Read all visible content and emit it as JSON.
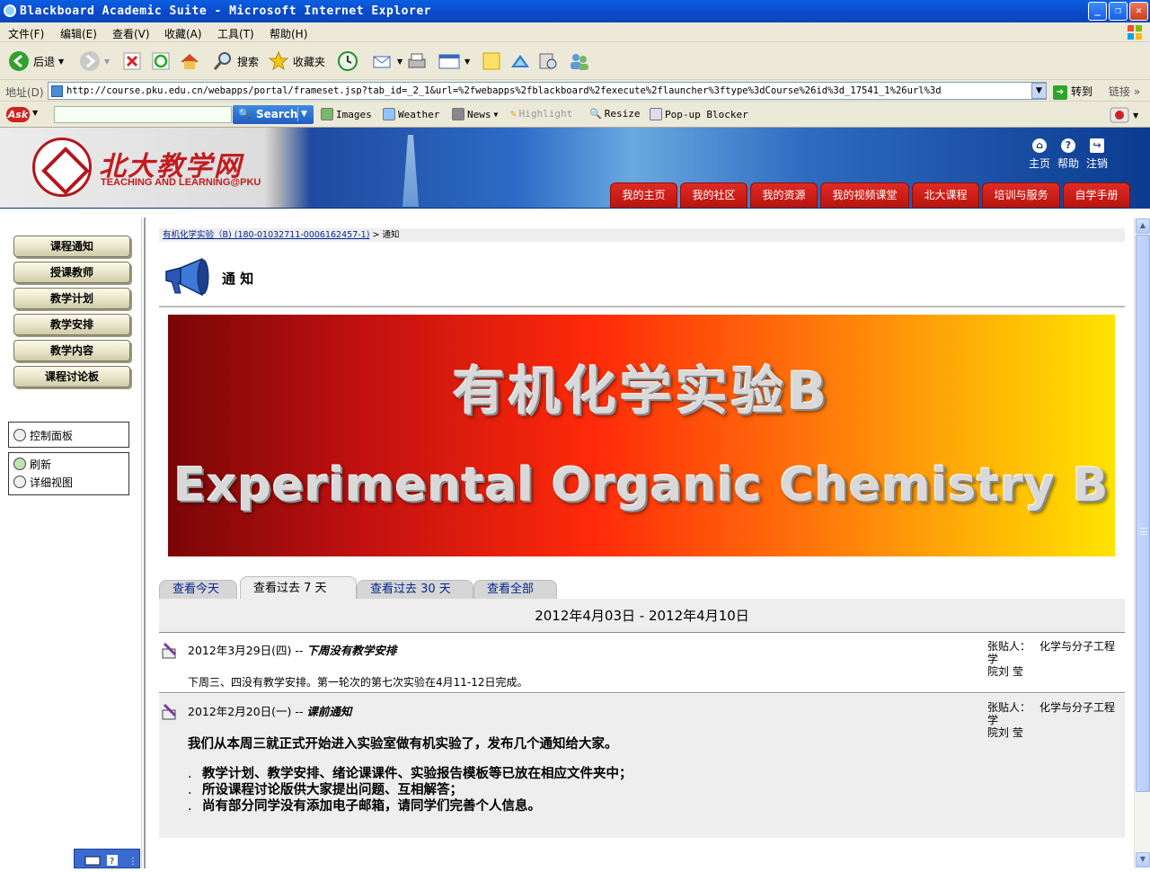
{
  "window": {
    "title": "Blackboard Academic Suite - Microsoft Internet Explorer"
  },
  "menu": [
    "文件(F)",
    "编辑(E)",
    "查看(V)",
    "收藏(A)",
    "工具(T)",
    "帮助(H)"
  ],
  "toolbar": {
    "back": "后退",
    "search": "搜索",
    "favorites": "收藏夹"
  },
  "address": {
    "label": "地址(D)",
    "url": "http://course.pku.edu.cn/webapps/portal/frameset.jsp?tab_id=_2_1&url=%2fwebapps%2fblackboard%2fexecute%2flauncher%3ftype%3dCourse%26id%3d_17541_1%26url%3d",
    "go": "转到",
    "links": "链接"
  },
  "askbar": {
    "logo": "Ask",
    "search": "Search",
    "items": [
      "Images",
      "Weather",
      "News",
      "Highlight",
      "Resize",
      "Pop-up Blocker"
    ]
  },
  "header": {
    "logo_cn": "北大教学网",
    "logo_en": "TEACHING AND LEARNING@PKU",
    "toplinks": [
      "主页",
      "帮助",
      "注销"
    ],
    "nav": [
      "我的主页",
      "我的社区",
      "我的资源",
      "我的视频课堂",
      "北大课程",
      "培训与服务",
      "自学手册"
    ]
  },
  "sidebar": {
    "buttons": [
      "课程通知",
      "授课教师",
      "教学计划",
      "教学安排",
      "教学内容",
      "课程讨论板"
    ],
    "control_panel": "控制面板",
    "refresh": "刷新",
    "detail_view": "详细视图"
  },
  "content": {
    "breadcrumb_link": "有机化学实验（B) (180-01032711-0006162457-1)",
    "breadcrumb_current": "通知",
    "page_title": "通 知",
    "banner_cn": "有机化学实验B",
    "banner_en": "Experimental Organic Chemistry B",
    "tabs": [
      "查看今天",
      "查看过去 7 天",
      "查看过去 30 天",
      "查看全部"
    ],
    "date_range": "2012年4月03日  - 2012年4月10日",
    "announcements": [
      {
        "date": "2012年3月29日(四) -- ",
        "subject": "下周没有教学安排",
        "poster_label": "张贴人：",
        "poster_dept": "化学与分子工程学",
        "poster_name": "院刘 莹",
        "body": "下周三、四没有教学安排。第一轮次的第七次实验在4月11-12日完成。"
      },
      {
        "date": "2012年2月20日(一) -- ",
        "subject": "课前通知",
        "poster_label": "张贴人：",
        "poster_dept": "化学与分子工程学",
        "poster_name": "院刘 莹",
        "body": "我们从本周三就正式开始进入实验室做有机实验了，发布几个通知给大家。",
        "bullets": [
          "教学计划、教学安排、绪论课课件、实验报告模板等已放在相应文件夹中；",
          "所设课程讨论版供大家提出问题、互相解答；",
          "尚有部分同学没有添加电子邮箱，请同学们完善个人信息。"
        ]
      }
    ]
  }
}
